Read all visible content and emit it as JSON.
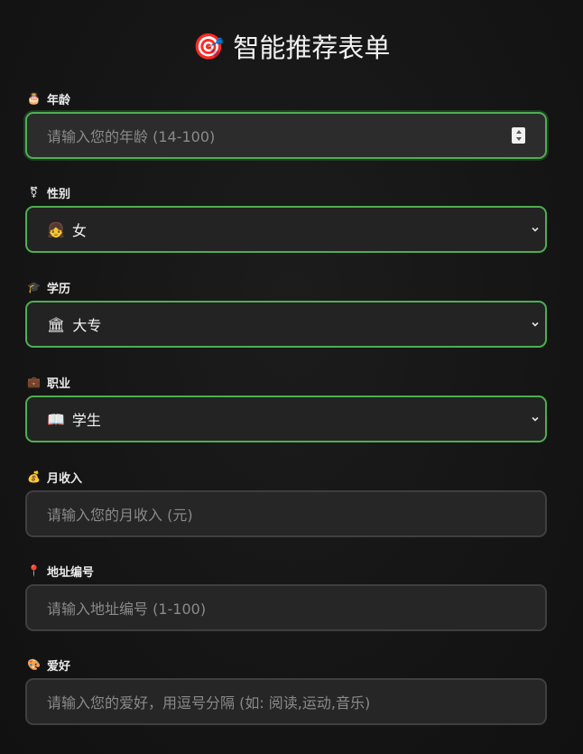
{
  "header": {
    "title": "智能推荐表单",
    "icon": "🎯"
  },
  "fields": {
    "age": {
      "icon": "🎂",
      "label": "年龄",
      "placeholder": "请输入您的年龄 (14-100)"
    },
    "gender": {
      "icon": "⚧",
      "label": "性别",
      "value_icon": "👧",
      "value": "女"
    },
    "education": {
      "icon": "🎓",
      "label": "学历",
      "value_icon": "🏛",
      "value": "大专"
    },
    "occupation": {
      "icon": "💼",
      "label": "职业",
      "value_icon": "📖",
      "value": "学生"
    },
    "income": {
      "icon": "💰",
      "label": "月收入",
      "placeholder": "请输入您的月收入 (元)"
    },
    "address": {
      "icon": "📍",
      "label": "地址编号",
      "placeholder": "请输入地址编号 (1-100)"
    },
    "hobbies": {
      "icon": "🎨",
      "label": "爱好",
      "placeholder": "请输入您的爱好，用逗号分隔 (如: 阅读,运动,音乐)"
    }
  },
  "colors": {
    "accent": "#4caf50",
    "background": "#151515",
    "field_bg": "#262626"
  }
}
